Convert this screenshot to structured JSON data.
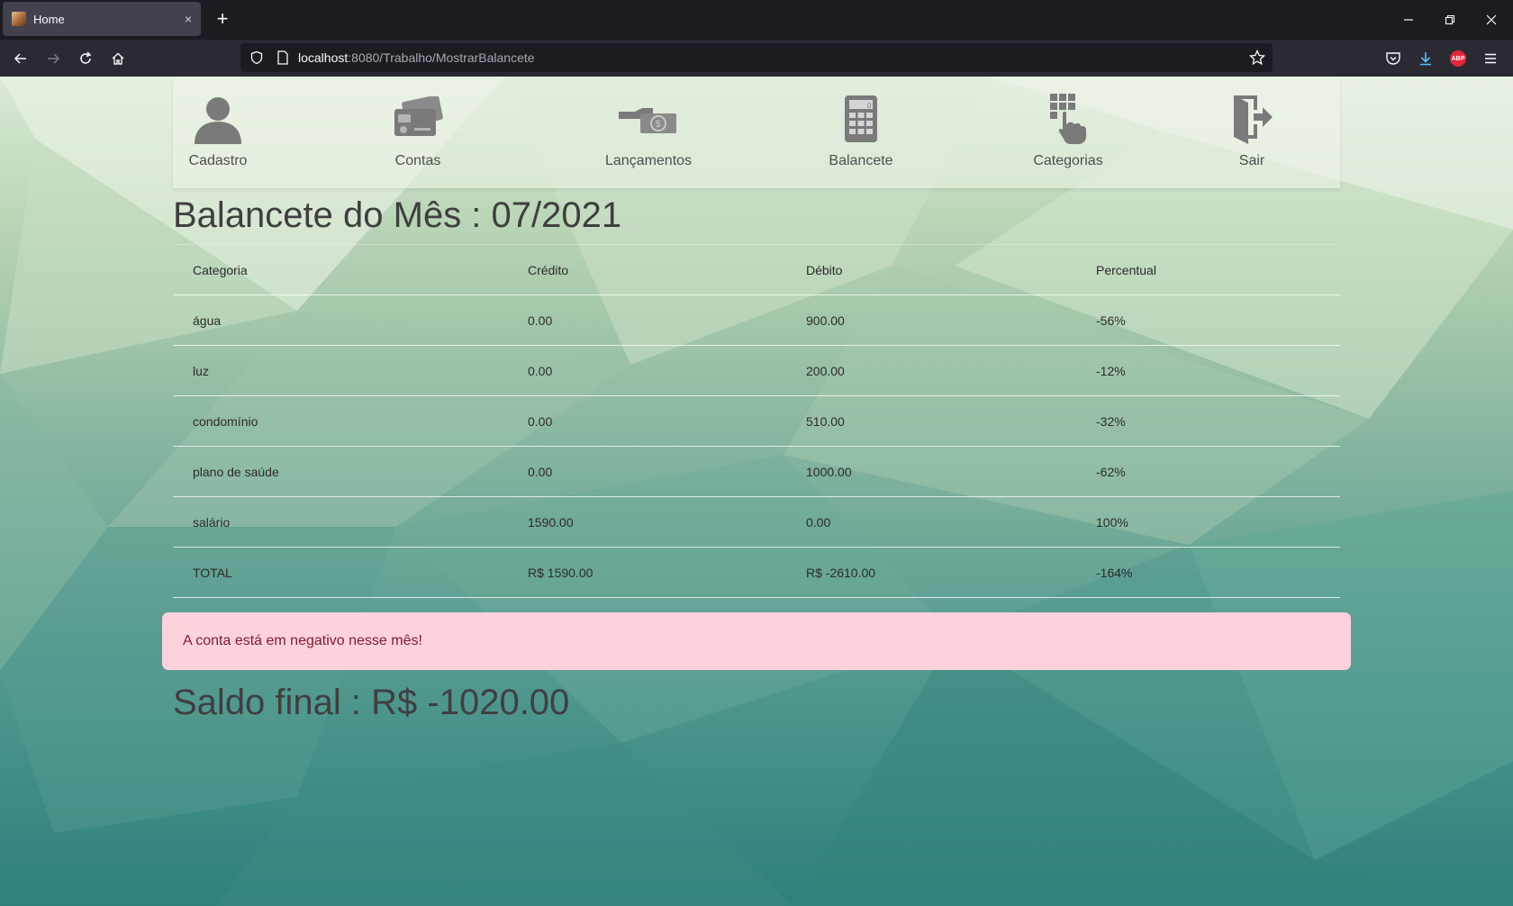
{
  "browser": {
    "tab_title": "Home",
    "tab_close": "×",
    "new_tab": "+",
    "url_host": "localhost",
    "url_path": ":8080/Trabalho/MostrarBalancete",
    "abp_label": "ABP"
  },
  "menu": {
    "items": [
      {
        "label": "Cadastro",
        "icon": "user-icon"
      },
      {
        "label": "Contas",
        "icon": "credit-card-icon"
      },
      {
        "label": "Lançamentos",
        "icon": "cash-hand-icon"
      },
      {
        "label": "Balancete",
        "icon": "calculator-icon"
      },
      {
        "label": "Categorias",
        "icon": "keypad-touch-icon"
      },
      {
        "label": "Sair",
        "icon": "exit-door-icon"
      }
    ]
  },
  "page": {
    "title": "Balancete do Mês : 07/2021",
    "alert": "A conta está em negativo nesse mês!",
    "saldo": "Saldo final : R$ -1020.00"
  },
  "table": {
    "headers": [
      "Categoria",
      "Crédito",
      "Débito",
      "Percentual"
    ],
    "rows": [
      [
        "água",
        "0.00",
        "900.00",
        "-56%"
      ],
      [
        "luz",
        "0.00",
        "200.00",
        "-12%"
      ],
      [
        "condomínio",
        "0.00",
        "510.00",
        "-32%"
      ],
      [
        "plano de saúde",
        "0.00",
        "1000.00",
        "-62%"
      ],
      [
        "salário",
        "1590.00",
        "0.00",
        "100%"
      ],
      [
        "TOTAL",
        "R$ 1590.00",
        "R$ -2610.00",
        "-164%"
      ]
    ]
  },
  "colors": {
    "alert_bg": "#fed2dc",
    "alert_text": "#7e1a2e",
    "icon_gray": "#7a7a7a"
  }
}
